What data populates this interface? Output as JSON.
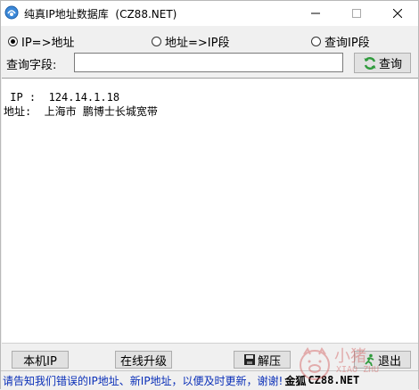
{
  "window": {
    "title": "纯真IP地址数据库  (CZ88.NET)"
  },
  "radios": [
    {
      "label": "IP=>地址",
      "checked": true
    },
    {
      "label": "地址=>IP段",
      "checked": false
    },
    {
      "label": "查询IP段",
      "checked": false
    }
  ],
  "query": {
    "label": "查询字段:",
    "value": "",
    "button": "查询"
  },
  "result": {
    "line1": " IP :  124.14.1.18",
    "line2": "地址:  上海市 鹏博士长城宽带"
  },
  "buttons": {
    "local_ip": "本机IP",
    "online_update": "在线升级",
    "extract": "解压",
    "exit": "退出"
  },
  "statusbar": {
    "message": "请告知我们错误的IP地址、新IP地址，以便及时更新，谢谢!",
    "gold": "金狐",
    "site": "CZ88.NET"
  },
  "watermark": {
    "text": "小猪",
    "sub": "XIAO ZHU"
  },
  "colors": {
    "status_text": "#0a2fb8",
    "refresh_icon": "#2e9a3b"
  },
  "icons": [
    "app-globe-icon",
    "minimize-icon",
    "maximize-icon",
    "close-icon",
    "refresh-icon",
    "disk-icon",
    "exit-runner-icon"
  ]
}
